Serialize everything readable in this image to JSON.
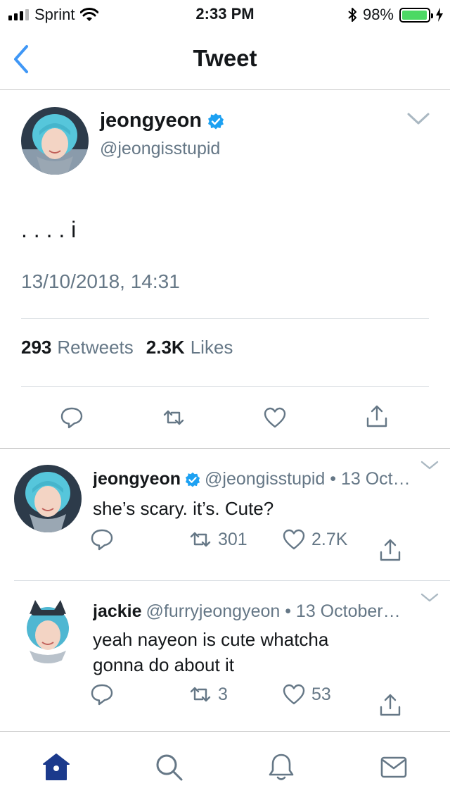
{
  "status_bar": {
    "carrier": "Sprint",
    "time": "2:33 PM",
    "battery_percent": "98%",
    "battery_level": 0.98,
    "signal_bars_on": 3,
    "signal_bars_total": 5
  },
  "nav": {
    "title": "Tweet",
    "back_icon": "chevron-left-icon"
  },
  "main_tweet": {
    "display_name": "jeongyeon",
    "verified": true,
    "handle": "@jeongisstupid",
    "text": ". . . . i",
    "timestamp": "13/10/2018, 14:31",
    "retweet_count": "293",
    "retweet_label": "Retweets",
    "like_count": "2.3K",
    "like_label": "Likes"
  },
  "replies": [
    {
      "display_name": "jeongyeon",
      "verified": true,
      "meta": "@jeongisstupid • 13 Oct…",
      "text": "she’s scary. it’s. Cute?",
      "retweets": "301",
      "likes": "2.7K"
    },
    {
      "display_name": "jackie",
      "verified": false,
      "meta": "@furryjeongyeon • 13 October…",
      "text_line1": "yeah nayeon is cute whatcha",
      "text_line2": "gonna do about it",
      "retweets": "3",
      "likes": "53"
    }
  ],
  "tab_bar": {
    "tabs": [
      "home-icon",
      "search-icon",
      "notifications-icon",
      "messages-icon"
    ],
    "active": "home-icon"
  },
  "colors": {
    "accent": "#1da1f2",
    "nav_back": "#3f97f6",
    "secondary_text": "#657786",
    "icon_gray": "#657786",
    "tab_active": "#1b3a8c",
    "battery_fill": "#4cd964"
  }
}
